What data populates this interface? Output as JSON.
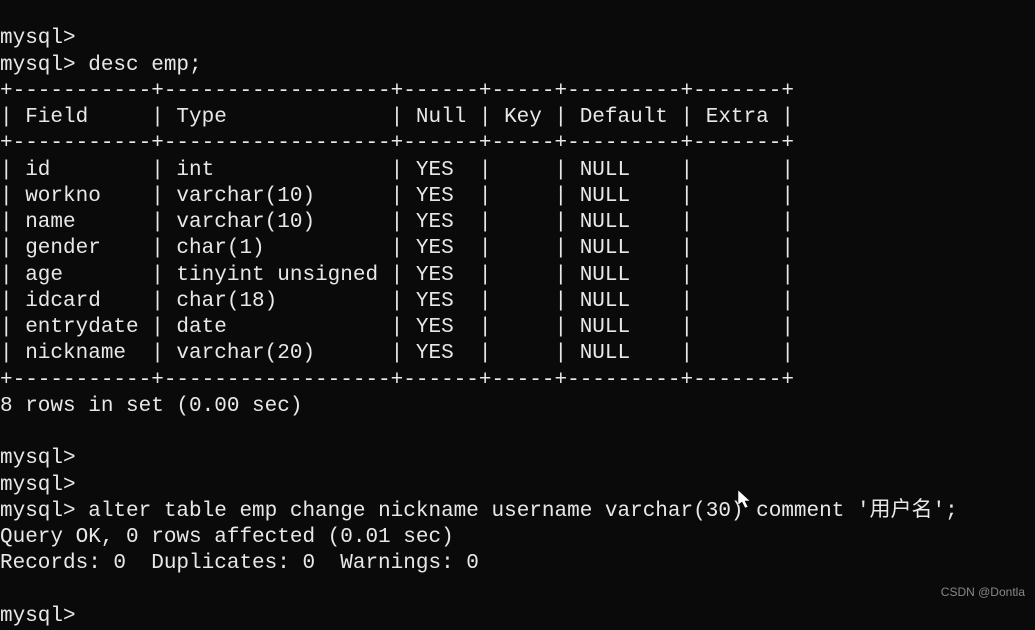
{
  "prompts": {
    "p1": "mysql>",
    "p2": "mysql> ",
    "p3": "mysql> ",
    "p4": "mysql>",
    "p5": "mysql>",
    "p6": "mysql> ",
    "p7": "mysql>"
  },
  "commands": {
    "desc": "desc emp;",
    "alter": "alter table emp change nickname username varchar(30) comment '用户名';"
  },
  "table": {
    "border_top": "+-----------+------------------+------+-----+---------+-------+",
    "border_mid": "+-----------+------------------+------+-----+---------+-------+",
    "border_bot": "+-----------+------------------+------+-----+---------+-------+",
    "header": "| Field     | Type             | Null | Key | Default | Extra |",
    "rows": [
      "| id        | int              | YES  |     | NULL    |       |",
      "| workno    | varchar(10)      | YES  |     | NULL    |       |",
      "| name      | varchar(10)      | YES  |     | NULL    |       |",
      "| gender    | char(1)          | YES  |     | NULL    |       |",
      "| age       | tinyint unsigned | YES  |     | NULL    |       |",
      "| idcard    | char(18)         | YES  |     | NULL    |       |",
      "| entrydate | date             | YES  |     | NULL    |       |",
      "| nickname  | varchar(20)      | YES  |     | NULL    |       |"
    ]
  },
  "results": {
    "rows_in_set": "8 rows in set (0.00 sec)",
    "query_ok": "Query OK, 0 rows affected (0.01 sec)",
    "records": "Records: 0  Duplicates: 0  Warnings: 0"
  },
  "watermark": "CSDN @Dontla"
}
